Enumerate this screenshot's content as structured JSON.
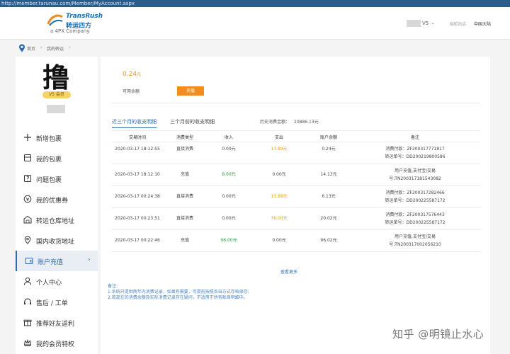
{
  "browser": {
    "url": "http://member.tarunau.com/Member/MyAccount.aspx"
  },
  "header": {
    "logo_en": "TransRush",
    "logo_cn": "转运四方",
    "logo_sub": "a 4PX Company",
    "user_level": "V5",
    "site_label": "当前站点:",
    "site_value": "中国大陆",
    "brand_color": "#1a6fb0"
  },
  "breadcrumb": {
    "home": "首页",
    "current": "我的转运"
  },
  "profile": {
    "avatar_char": "撸",
    "vip_badge": "V5 会员"
  },
  "sidebar": {
    "items": [
      {
        "label": "新增包裹",
        "icon": "plus-icon"
      },
      {
        "label": "我的包裹",
        "icon": "package-icon"
      },
      {
        "label": "问题包裹",
        "icon": "problem-package-icon"
      },
      {
        "label": "我的优惠券",
        "icon": "coupon-icon"
      },
      {
        "label": "转运仓库地址",
        "icon": "warehouse-icon"
      },
      {
        "label": "国内收货地址",
        "icon": "location-icon"
      },
      {
        "label": "账户充值",
        "icon": "wallet-icon",
        "active": true
      },
      {
        "label": "个人中心",
        "icon": "user-icon"
      },
      {
        "label": "售后 / 工单",
        "icon": "service-icon"
      },
      {
        "label": "推荐好友返利",
        "icon": "gift-icon"
      },
      {
        "label": "我的会员特权",
        "icon": "crown-icon"
      }
    ],
    "active_color": "#2b6cb0"
  },
  "account": {
    "balance": "0.24",
    "balance_unit": "元",
    "balance_label": "可用余额",
    "recharge_label": "充值",
    "recharge_color": "#f28c1c"
  },
  "tabs": [
    {
      "label": "近三个月的收支明细",
      "active": true
    },
    {
      "label": "三个月前的收支明细",
      "active": false
    }
  ],
  "history": {
    "label": "历史消费金额：",
    "value": "20886.13元"
  },
  "table": {
    "headers": [
      "交易时间",
      "消费类型",
      "收入",
      "支出",
      "账户余额",
      "备注"
    ],
    "rows": [
      {
        "time": "2020-03-17 18:12:55",
        "type": "直接消费",
        "income": "0.00元",
        "expense": "13.89元",
        "balance": "0.24元",
        "note1": "消费付款：ZF200317771817",
        "note2": "转运单号：DD200219800586"
      },
      {
        "time": "2020-03-17 18:12:10",
        "type": "充值",
        "income": "8.00元",
        "expense": "0.00元",
        "balance": "14.13元",
        "note1": "用户充值,支付宝/交易",
        "note2": "号:TN200317181543082"
      },
      {
        "time": "2020-03-17 00:24:38",
        "type": "直接消费",
        "income": "0.00元",
        "expense": "13.89元",
        "balance": "6.13元",
        "note1": "消费付款：ZF200317282466",
        "note2": "转运单号：DD200225587172"
      },
      {
        "time": "2020-03-17 00:23:51",
        "type": "直接消费",
        "income": "0.00元",
        "expense": "76.00元",
        "balance": "20.02元",
        "note1": "消费付款：ZF200317576443",
        "note2": "转运单号：DD200225587172"
      },
      {
        "time": "2020-03-17 00:22:46",
        "type": "充值",
        "income": "96.00元",
        "expense": "0.00元",
        "balance": "96.02元",
        "note1": "用户充值,支付宝/交易",
        "note2": "号:TN200317002056210"
      }
    ]
  },
  "more_label": "查看更多",
  "notes": {
    "title": "备注:",
    "lines": [
      "1.系统只提供两年内消费记录，如果有需要，可提前按照各自方式存档保存;",
      "2.若现在的消费余额及实际消费记录存在疑问，不适用于所有账目明细中。"
    ]
  },
  "watermark": "知乎 @明镜止水心"
}
